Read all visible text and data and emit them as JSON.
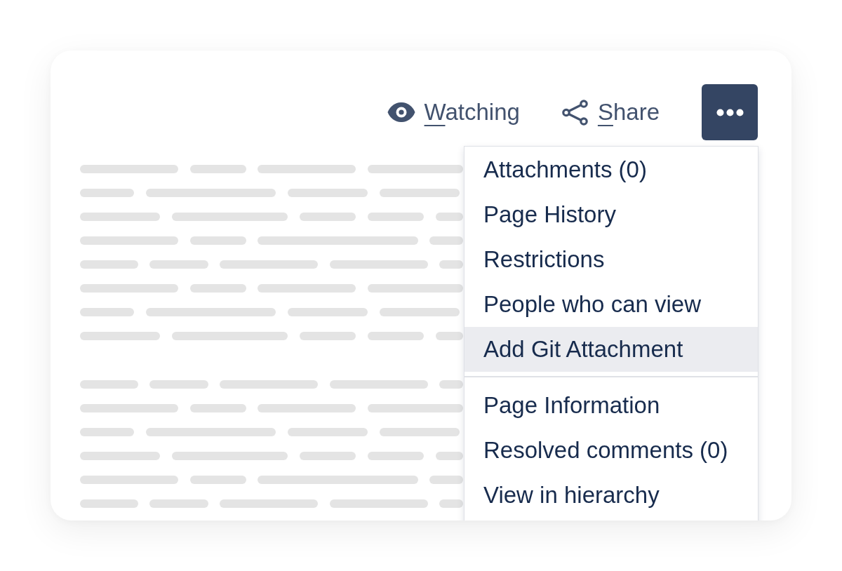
{
  "toolbar": {
    "actions": [
      {
        "kind": "watch",
        "label": "Watching"
      },
      {
        "kind": "share",
        "label": "Share"
      }
    ],
    "more_button": {
      "expanded": true
    }
  },
  "menu": {
    "sections": [
      {
        "items": [
          {
            "label": "Attachments (0)",
            "selected": false
          },
          {
            "label": "Page History",
            "selected": false
          },
          {
            "label": "Restrictions",
            "selected": false
          },
          {
            "label": "People who can view",
            "selected": false
          },
          {
            "label": "Add Git Attachment",
            "selected": true
          }
        ]
      },
      {
        "items": [
          {
            "label": "Page Information",
            "selected": false
          },
          {
            "label": "Resolved comments (0)",
            "selected": false
          },
          {
            "label": "View in hierarchy",
            "selected": false
          }
        ]
      }
    ]
  }
}
